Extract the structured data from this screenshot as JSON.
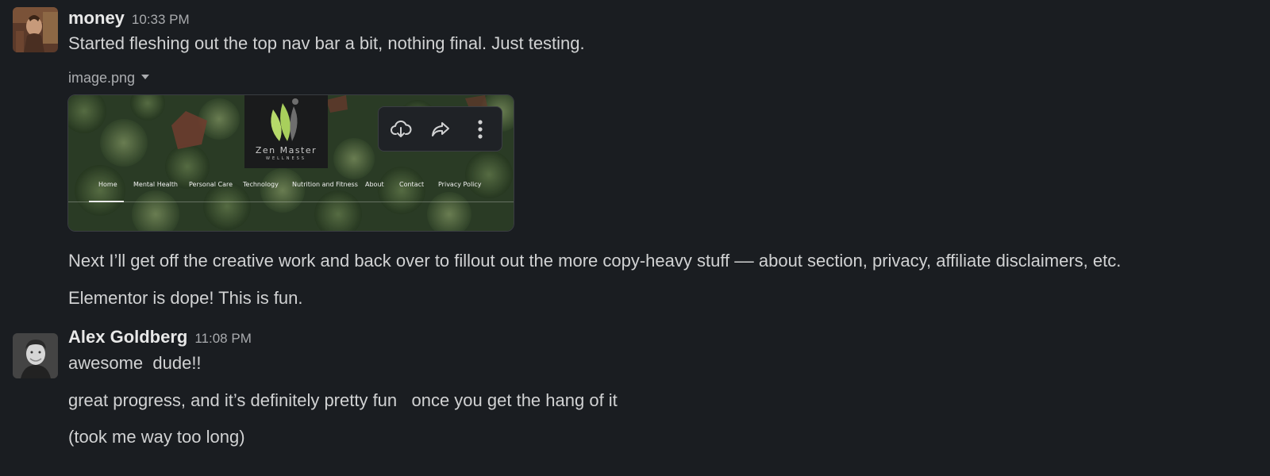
{
  "messages": [
    {
      "sender": "money",
      "timestamp": "10:33 PM",
      "lines": [
        "Started fleshing out the top nav bar a bit, nothing final. Just testing.",
        "Next I’ll get off the creative work and back over to fillout out the more copy-heavy stuff –– about section, privacy, affiliate disclaimers, etc.",
        "Elementor is dope! This is fun."
      ],
      "attachment": {
        "filename": "image.png",
        "preview": {
          "logo_title": "Zen Master",
          "logo_subtitle": "WELLNESS",
          "nav_items": [
            "Home",
            "Mental Health",
            "Personal Care",
            "Technology",
            "Nutrition and Fitness",
            "About",
            "Contact",
            "Privacy Policy"
          ],
          "active_nav": "Home"
        },
        "actions": [
          {
            "name": "download-icon",
            "label": "Download"
          },
          {
            "name": "share-icon",
            "label": "Share"
          },
          {
            "name": "more-actions-icon",
            "label": "More actions"
          }
        ]
      }
    },
    {
      "sender": "Alex Goldberg",
      "timestamp": "11:08 PM",
      "lines": [
        "awesome  dude!!",
        "great progress, and it’s definitely pretty fun   once you get the hang of it",
        "(took me way too long)"
      ]
    }
  ],
  "colors": {
    "background": "#1a1d21",
    "text": "#d1d2d3",
    "sender": "#e8e8e8",
    "muted": "#a9abae"
  }
}
